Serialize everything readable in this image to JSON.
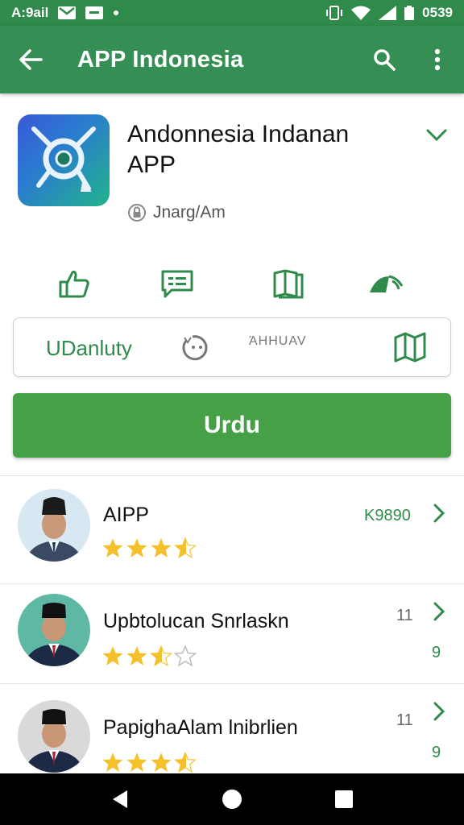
{
  "statusbar": {
    "carrier": "A:9ail",
    "time": "0539",
    "icons": [
      "gmail-icon",
      "mail-icon",
      "notification-dot-icon",
      "vibrate-icon",
      "wifi-icon",
      "signal-icon",
      "battery-icon"
    ]
  },
  "appbar": {
    "title": "APP Indonesia",
    "icons": [
      "back-arrow-icon",
      "search-icon",
      "more-vert-icon"
    ]
  },
  "app": {
    "name": "Andonnesia Indanan APP",
    "developer": "Jnarg/Am",
    "colors": {
      "gradient_start": "#3a58d8",
      "gradient_end": "#22b38a"
    }
  },
  "actions": {
    "icons": [
      "thumbs-up-icon",
      "message-icon",
      "book-icon",
      "share-icon"
    ]
  },
  "info": {
    "label": "UDanluty",
    "small_text": "ΆΗΗUAV"
  },
  "install_button": {
    "label": "Urdu",
    "color": "#45a046"
  },
  "reviews": [
    {
      "name": "AIPP",
      "rating": 3.5,
      "meta": "K9890",
      "meta2": ""
    },
    {
      "name": "Upbtolucan Snrlaskn",
      "rating": 2.5,
      "meta": "11",
      "meta2": "9"
    },
    {
      "name": "PapighaAlam lnibrlien",
      "rating": 3.5,
      "meta": "11",
      "meta2": "9"
    }
  ],
  "navbar": {
    "icons": [
      "back-triangle-icon",
      "home-circle-icon",
      "recents-square-icon"
    ]
  },
  "theme": {
    "primary": "#358e54",
    "accent": "#2f8a4b",
    "star": "#f4c12a"
  }
}
